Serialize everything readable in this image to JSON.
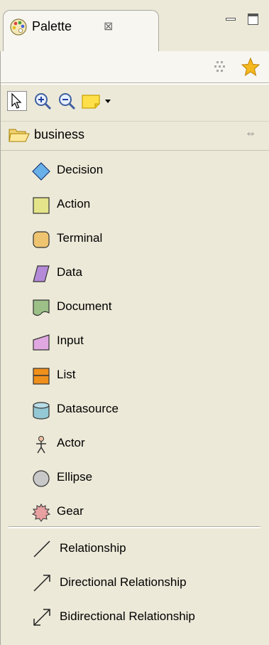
{
  "view": {
    "tab_title": "Palette",
    "tab_icon": "palette-icon",
    "tab_close_glyph": "⊠",
    "minimize_icon": "minimize-icon",
    "maximize_icon": "maximize-icon"
  },
  "toolbar": {
    "customize_icon": "customize-icon",
    "pin_icon": "star-icon"
  },
  "tools": [
    {
      "name": "select-tool",
      "icon": "arrow-cursor-icon"
    },
    {
      "name": "zoom-in-tool",
      "icon": "zoom-in-icon"
    },
    {
      "name": "zoom-out-tool",
      "icon": "zoom-out-icon"
    },
    {
      "name": "note-tool",
      "icon": "note-icon"
    }
  ],
  "drawer": {
    "label": "business",
    "icon": "open-folder-icon",
    "collapse_glyph": "⇔"
  },
  "entries": [
    {
      "label": "Decision",
      "icon": "diamond-icon",
      "color": "#6ab0e8"
    },
    {
      "label": "Action",
      "icon": "square-icon",
      "color": "#e4e48a"
    },
    {
      "label": "Terminal",
      "icon": "rounded-square-icon",
      "color": "#eec470"
    },
    {
      "label": "Data",
      "icon": "parallelogram-icon",
      "color": "#b48ad8"
    },
    {
      "label": "Document",
      "icon": "document-shape-icon",
      "color": "#9cc088"
    },
    {
      "label": "Input",
      "icon": "input-shape-icon",
      "color": "#e0a8e0"
    },
    {
      "label": "List",
      "icon": "list-shape-icon",
      "color": "#f0901c"
    },
    {
      "label": "Datasource",
      "icon": "cylinder-icon",
      "color": "#94c8d4"
    },
    {
      "label": "Actor",
      "icon": "stick-figure-icon",
      "color": "#d08060"
    },
    {
      "label": "Ellipse",
      "icon": "circle-icon",
      "color": "#c8c8c8"
    },
    {
      "label": "Gear",
      "icon": "gear-icon",
      "color": "#e8a0a0"
    }
  ],
  "connections": [
    {
      "label": "Relationship",
      "icon": "line-icon"
    },
    {
      "label": "Directional Relationship",
      "icon": "arrow-line-icon"
    },
    {
      "label": "Bidirectional Relationship",
      "icon": "double-arrow-line-icon"
    }
  ]
}
